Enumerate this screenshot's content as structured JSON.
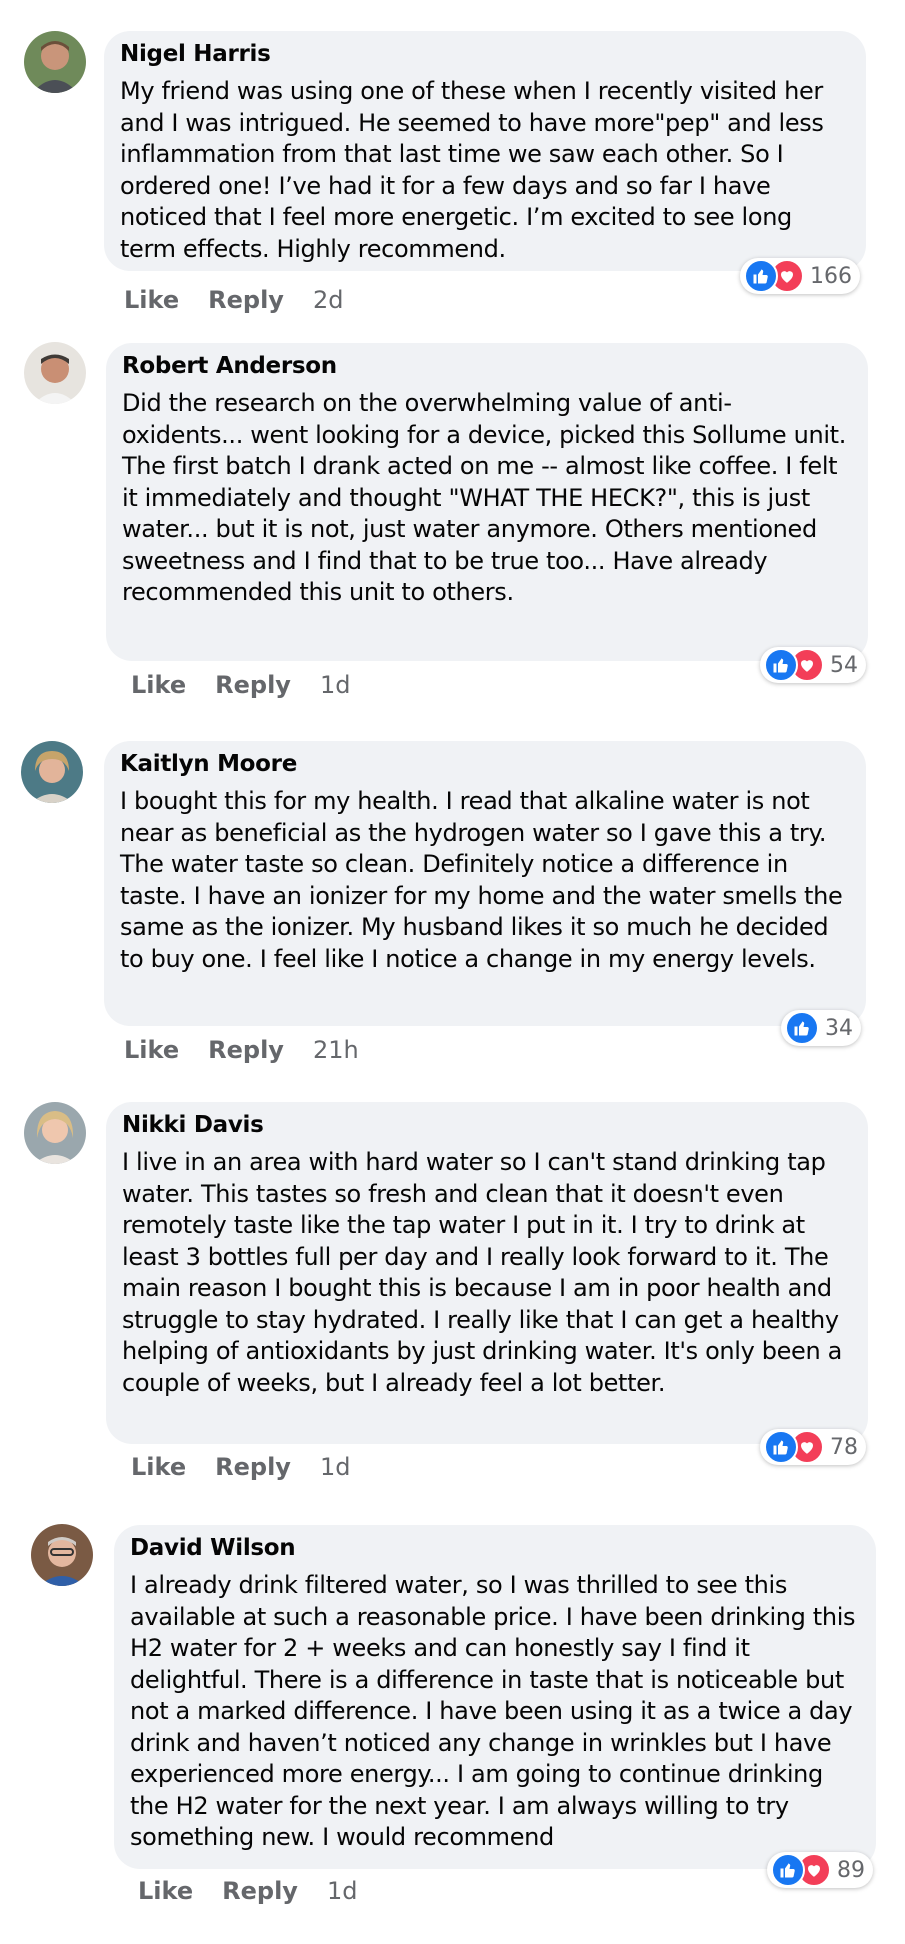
{
  "comments": [
    {
      "author": "Nigel Harris",
      "text": "My friend was using one of these when I recently visited her and I was intrigued. He seemed to have more\"pep\" and less inflammation from that last time we saw each other. So I ordered one! I’ve had it for a few days and so far I have noticed that I feel more energetic. I’m excited to see long term effects. Highly recommend.",
      "reaction_count": "166",
      "like_label": "Like",
      "reply_label": "Reply",
      "time": "2d"
    },
    {
      "author": "Robert Anderson",
      "text": "Did the research on the overwhelming value of anti-oxidents... went looking for a device, picked this Sollume unit. The first batch I drank acted on me -- almost like coffee. I felt it immediately and thought \"WHAT THE HECK?\", this is just water... but it is not, just water anymore. Others mentioned sweetness and I find that to be true too... Have already recommended this unit to others.",
      "reaction_count": "54",
      "like_label": "Like",
      "reply_label": "Reply",
      "time": "1d"
    },
    {
      "author": "Kaitlyn Moore",
      "text": "I bought this for my health. I read that alkaline water is not near as beneficial as the hydrogen water so I gave this a try. The water taste so clean. Definitely notice a difference in taste. I have an ionizer for my home and the water smells the same as the ionizer. My husband likes it so much he decided to buy one. I feel like I notice a change in my energy levels.",
      "reaction_count": "34",
      "like_label": "Like",
      "reply_label": "Reply",
      "time": "21h"
    },
    {
      "author": "Nikki Davis",
      "text": "I live in an area with hard water so I can't stand drinking tap water. This tastes so fresh and clean that it doesn't even remotely taste like the tap water I put in it. I try to drink at least 3 bottles full per day and I really look forward to it. The main reason I bought this is because I am in poor health and struggle to stay hydrated. I really like that I can get a healthy helping of antioxidants by just drinking water. It's only been a couple of weeks, but I already feel a lot better.",
      "reaction_count": "78",
      "like_label": "Like",
      "reply_label": "Reply",
      "time": "1d"
    },
    {
      "author": "David Wilson",
      "text": "I already drink filtered water, so I was thrilled to see this available at such a reasonable price. I have been drinking this H2 water for 2 + weeks and can honestly say I find it delightful. There is a difference in taste that is noticeable but not a marked difference. I have been using it as a twice a day drink and haven’t noticed any change in wrinkles but I have experienced more energy... I am going to continue drinking the H2 water for the next year. I am always willing to try something new. I would recommend",
      "reaction_count": "89",
      "like_label": "Like",
      "reply_label": "Reply",
      "time": "1d"
    }
  ],
  "colors": {
    "bubble_bg": "#f0f2f5",
    "like_blue": "#1877f2",
    "love_red": "#f33e58",
    "meta_gray": "#65676b"
  }
}
